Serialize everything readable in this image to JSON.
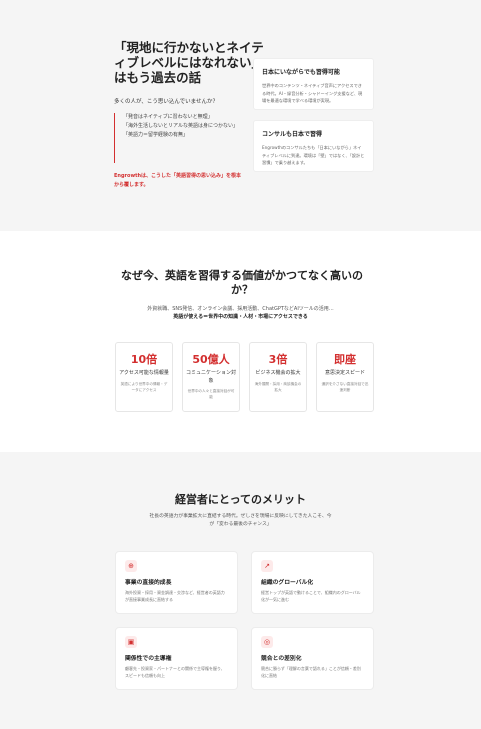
{
  "section1": {
    "title": "「現地に行かないとネイティブレベルにはなれない」はもう過去の話",
    "subtitle": "多くの人が、こう思い込んでいませんか？",
    "quotes": [
      "「発音はネイティブに習わないと無理」",
      "「海外生活しないとリアルな英語は身につかない」",
      "「英語力＝留学経験の有無」"
    ],
    "note": "Engrowthは、こうした「英語習得の思い込み」を根本から覆します。",
    "cards": [
      {
        "title": "日本にいながらでも習得可能",
        "body": "世界中のコンテンツ・ネイティブ音声にアクセスできる時代。AI・録音分析・シャドーイング支援など、現場を最適な環境で学べる環境が実現。"
      },
      {
        "title": "コンサルも日本で習得",
        "body": "Engrowthのコンサルたちも「日本にいながら」ネイティブレベルに到達。環境は「壁」ではなく、「設計と習慣」で乗り越えます。"
      }
    ]
  },
  "section2": {
    "title": "なぜ今、英語を習得する価値がかつてなく高いのか？",
    "subtitle": "外資就職、SNS発信、オンライン会議、採用活動、ChatGPTなどAIツールの活用…",
    "subtitle_bold": "英語が使える＝世界中の知識・人材・市場にアクセスできる",
    "stats": [
      {
        "num": "10倍",
        "label": "アクセス可能な情報量",
        "desc": "英語により世界中の情報・データにアクセス"
      },
      {
        "num": "50億人",
        "label": "コミュニケーション対象",
        "desc": "世界中の人々と直接対話が可能"
      },
      {
        "num": "3倍",
        "label": "ビジネス機会の拡大",
        "desc": "海外展開・採用・商談機会の拡大"
      },
      {
        "num": "即座",
        "label": "意思決定スピード",
        "desc": "通訳を介さない直接対話で迅速判断"
      }
    ]
  },
  "section3": {
    "title": "経営者にとってのメリット",
    "subtitle": "社長の英語力が事業拡大に直結する時代。ぜしさを現場に反映にしてきた人こそ、今が「変わる最後のチャンス」",
    "cards": [
      {
        "icon": "globe-icon",
        "glyph": "⊕",
        "title": "事業の直接的成長",
        "desc": "海外投資・採用・資金調達・交渉など、経営者の英語力が直接事業成長に直結する"
      },
      {
        "icon": "trend-icon",
        "glyph": "↗",
        "title": "組織のグローバル化",
        "desc": "経営トップが英語で動けることで、組織内のグローバル化が一気に進む"
      },
      {
        "icon": "briefcase-icon",
        "glyph": "▣",
        "title": "関係性での主導権",
        "desc": "顧客先・投資家・パートナーとの関係で主導権を握り、スピードも信頼も向上"
      },
      {
        "icon": "target-icon",
        "glyph": "◎",
        "title": "競合との差別化",
        "desc": "競合に勝らず「理解の言葉で語れる」ことが信頼・差別化に直結"
      }
    ]
  }
}
